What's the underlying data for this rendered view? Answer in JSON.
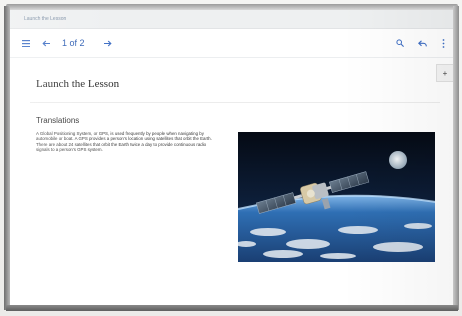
{
  "window": {
    "title": "Launch the Lesson"
  },
  "toolbar": {
    "page_indicator": "1 of 2",
    "icons": [
      "menu-icon",
      "arrow-left-icon",
      "arrow-right-icon",
      "search-icon",
      "reply-icon",
      "more-vertical-icon"
    ],
    "accent_color": "#3e6ec4"
  },
  "page": {
    "title": "Launch the Lesson",
    "sidebar_button_icon": "plus-icon",
    "section_heading": "Translations",
    "body_text": "A Global Positioning System, or GPS, is used frequently by people when navigating by automobile or boat. A GPS provides a person's location using satellites that orbit the Earth. There are about 24 satellites that orbit the Earth twice a day to provide continuous radio signals to a person's GPS system.",
    "image_subject": "satellite orbiting Earth with moon in background"
  }
}
